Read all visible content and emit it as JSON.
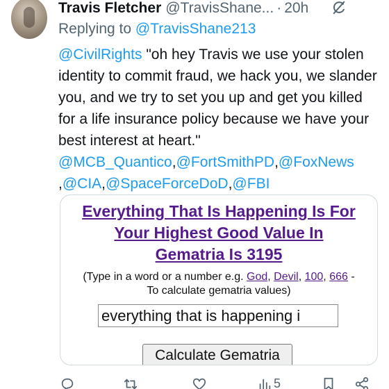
{
  "tweet": {
    "author_name": "Travis Fletcher",
    "author_handle": "@TravisShane...",
    "separator": "·",
    "time": "20h",
    "replying_prefix": "Replying to",
    "replying_to": "@TravisShane213",
    "text": {
      "mention_first": "@CivilRights",
      "quote": " \"oh hey Travis we use your stolen identity to commit fraud, we hack you, we slander you, and we try to set you up and get you killed for a life insurance policy because we have your best interest at heart.\"",
      "mention_mcb": "@MCB_Quantico",
      "mention_fortsmith": "@FortSmithPD",
      "mention_foxnews": "@FoxNews",
      "mention_cia": "@CIA",
      "mention_spaceforce": "@SpaceForceDoD",
      "mention_fbi": "@FBI"
    }
  },
  "card": {
    "title_line1": "Everything That Is Happening Is For",
    "title_line2": "Your Highest Good Value In",
    "title_line3": "Gematria Is 3195",
    "note_prefix": "(Type in a word or a number e.g.",
    "link_god": "God",
    "link_devil": "Devil",
    "link_100": "100",
    "link_666": "666",
    "note_suffix": "To calculate gematria values)",
    "input_value": "everything that is happening i",
    "button_label": "Calculate Gematria"
  },
  "actions": {
    "views_count": "5"
  }
}
